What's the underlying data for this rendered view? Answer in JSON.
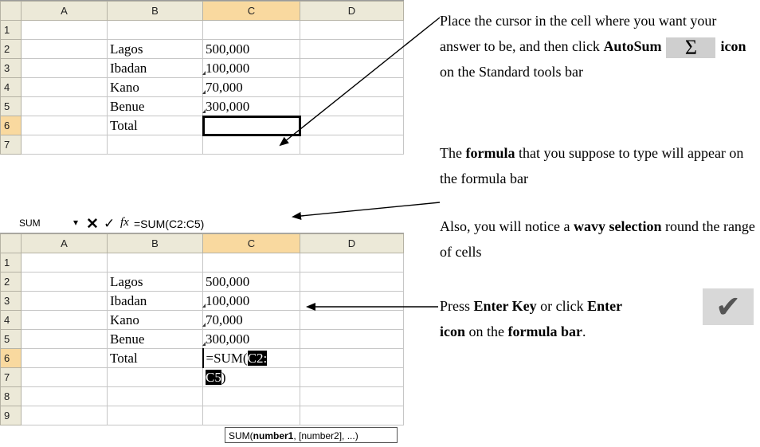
{
  "top_sheet": {
    "columns": [
      "",
      "A",
      "B",
      "C",
      "D"
    ],
    "rows": [
      {
        "num": "1",
        "b": "",
        "c": ""
      },
      {
        "num": "2",
        "b": "Lagos",
        "c": "500,000"
      },
      {
        "num": "3",
        "b": "Ibadan",
        "c": "100,000"
      },
      {
        "num": "4",
        "b": "Kano",
        "c": "70,000"
      },
      {
        "num": "5",
        "b": "Benue",
        "c": "300,000"
      },
      {
        "num": "6",
        "b": "Total",
        "c": ""
      },
      {
        "num": "7",
        "b": "",
        "c": ""
      }
    ]
  },
  "formula_bar": {
    "name_box": "SUM",
    "dropdown_icon": "dropdown-arrow-icon",
    "cancel_icon": "cancel-x-icon",
    "enter_icon": "enter-check-icon",
    "fx_label": "fx",
    "formula": "=SUM(C2:C5)"
  },
  "bottom_sheet": {
    "columns": [
      "",
      "A",
      "B",
      "C",
      "D"
    ],
    "rows": [
      {
        "num": "1",
        "b": "",
        "c": ""
      },
      {
        "num": "2",
        "b": "Lagos",
        "c": "500,000"
      },
      {
        "num": "3",
        "b": "Ibadan",
        "c": "100,000"
      },
      {
        "num": "4",
        "b": "Kano",
        "c": "70,000"
      },
      {
        "num": "5",
        "b": "Benue",
        "c": "300,000"
      },
      {
        "num": "6",
        "b": "Total",
        "c_prefix": "=SUM(",
        "c_hl": "C2:"
      },
      {
        "num": "7",
        "b": "",
        "c_hl": "C5",
        "c_suffix": ")"
      },
      {
        "num": "8",
        "b": "",
        "c": ""
      },
      {
        "num": "9",
        "b": "",
        "c": ""
      }
    ],
    "tooltip_prefix": "SUM(",
    "tooltip_bold": "number1",
    "tooltip_rest": ", [number2], ...)"
  },
  "notes": {
    "n1_a": "Place the cursor in the cell where you want your answer to be, and then click ",
    "n1_b": "AutoSum",
    "n1_icon": "Σ",
    "n1_c": "icon",
    "n1_d": " on the Standard tools bar",
    "n2_a": "The ",
    "n2_b": "formula",
    "n2_c": " that you suppose to type will appear on the formula bar",
    "n3_a": "Also, you will notice a ",
    "n3_b": "wavy selection",
    "n3_c": " round the range of cells",
    "n4_a": "Press ",
    "n4_b": "Enter Key",
    "n4_c": " or click ",
    "n4_d": "Enter",
    "n4_e": "icon",
    "n4_f": " on the ",
    "n4_g": "formula bar",
    "n4_h": ".",
    "check_glyph": "✔"
  }
}
